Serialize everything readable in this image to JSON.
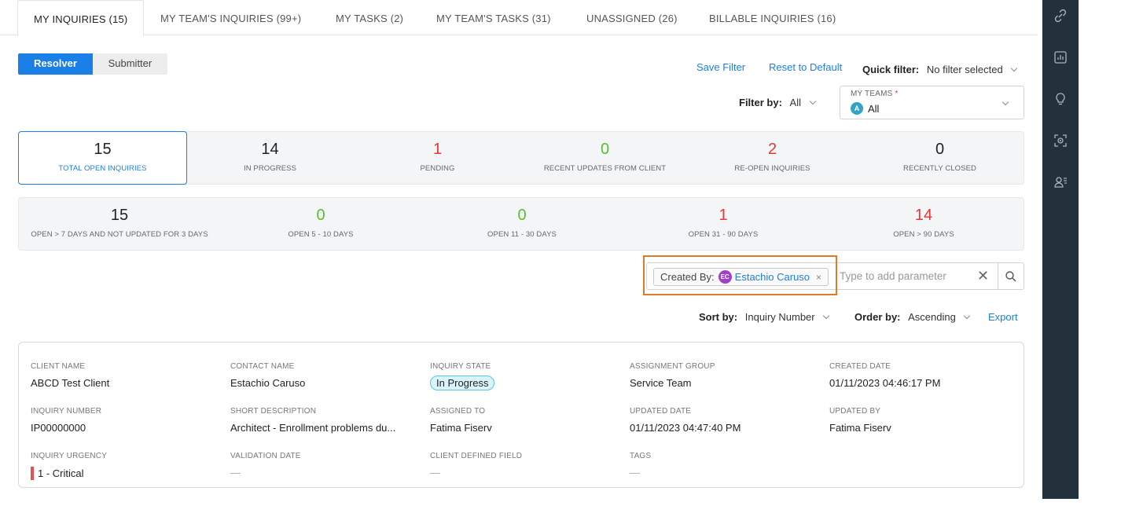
{
  "tabs": [
    {
      "label": "MY INQUIRIES (15)",
      "active": true
    },
    {
      "label": "MY TEAM'S INQUIRIES (99+)"
    },
    {
      "label": "MY TASKS (2)"
    },
    {
      "label": "MY TEAM'S TASKS (31)"
    },
    {
      "label": "UNASSIGNED (26)"
    },
    {
      "label": "BILLABLE INQUIRIES (16)"
    }
  ],
  "role_toggle": {
    "resolver": "Resolver",
    "submitter": "Submitter",
    "selected": "Resolver"
  },
  "toolbar": {
    "save_filter": "Save Filter",
    "reset": "Reset to Default",
    "quick_filter_label": "Quick filter:",
    "quick_filter_value": "No filter selected",
    "filter_by_label": "Filter by:",
    "filter_by_value": "All",
    "teams_caption": "MY TEAMS",
    "teams_required": "*",
    "teams_avatar": "A",
    "teams_value": "All"
  },
  "stats_row1": [
    {
      "value": "15",
      "label": "TOTAL OPEN INQUIRIES",
      "color": "#222222",
      "selected": true
    },
    {
      "value": "14",
      "label": "IN PROGRESS",
      "color": "#222222"
    },
    {
      "value": "1",
      "label": "PENDING",
      "color": "#e53935"
    },
    {
      "value": "0",
      "label": "RECENT UPDATES FROM CLIENT",
      "color": "#55c12f"
    },
    {
      "value": "2",
      "label": "RE-OPEN INQUIRIES",
      "color": "#e53935"
    },
    {
      "value": "0",
      "label": "RECENTLY CLOSED",
      "color": "#222222"
    }
  ],
  "stats_row2": [
    {
      "value": "15",
      "label": "OPEN > 7 DAYS AND NOT UPDATED FOR 3 DAYS",
      "color": "#222222"
    },
    {
      "value": "0",
      "label": "OPEN 5 - 10 DAYS",
      "color": "#55c12f"
    },
    {
      "value": "0",
      "label": "OPEN 11 - 30 DAYS",
      "color": "#55c12f"
    },
    {
      "value": "1",
      "label": "OPEN 31 - 90 DAYS",
      "color": "#e53935"
    },
    {
      "value": "14",
      "label": "OPEN > 90 DAYS",
      "color": "#e53935"
    }
  ],
  "search": {
    "chip_key": "Created By:",
    "chip_avatar": "EC",
    "chip_value": "Estachio Caruso",
    "chip_remove": "×",
    "placeholder": "Type to add parameter",
    "clear": "✕"
  },
  "sort": {
    "sort_label": "Sort by:",
    "sort_value": "Inquiry Number",
    "order_label": "Order by:",
    "order_value": "Ascending",
    "export": "Export"
  },
  "record": {
    "client_name": {
      "label": "CLIENT NAME",
      "value": "ABCD Test Client"
    },
    "contact_name": {
      "label": "CONTACT NAME",
      "value": "Estachio Caruso"
    },
    "inquiry_state": {
      "label": "INQUIRY STATE",
      "value": "In Progress"
    },
    "assignment_group": {
      "label": "ASSIGNMENT GROUP",
      "value": "Service Team"
    },
    "created_date": {
      "label": "CREATED DATE",
      "value": "01/11/2023 04:46:17 PM"
    },
    "inquiry_number": {
      "label": "INQUIRY NUMBER",
      "value": "IP00000000"
    },
    "short_description": {
      "label": "SHORT DESCRIPTION",
      "value": "Architect - Enrollment problems du..."
    },
    "assigned_to": {
      "label": "ASSIGNED TO",
      "value": "Fatima Fiserv"
    },
    "updated_date": {
      "label": "UPDATED DATE",
      "value": "01/11/2023 04:47:40 PM"
    },
    "updated_by": {
      "label": "UPDATED BY",
      "value": "Fatima Fiserv"
    },
    "inquiry_urgency": {
      "label": "INQUIRY URGENCY",
      "value": "1 - Critical"
    },
    "validation_date": {
      "label": "VALIDATION DATE",
      "value": "—"
    },
    "client_defined_field": {
      "label": "CLIENT DEFINED FIELD",
      "value": "—"
    },
    "tags": {
      "label": "TAGS",
      "value": "—"
    }
  },
  "sidebar_icons": [
    "link-icon",
    "chart-icon",
    "lightbulb-icon",
    "focus-icon",
    "user-list-icon"
  ]
}
